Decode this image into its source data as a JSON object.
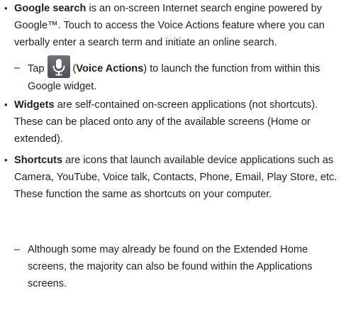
{
  "google_search": {
    "term": "Google search",
    "description": " is an on-screen Internet search engine powered by Google™. Touch to access the Voice Actions feature where you can verbally enter a search term and initiate an online search.",
    "sub_prefix": "Tap",
    "voice_actions_label": "Voice Actions",
    "sub_suffix": " to launch the function from within this Google widget.",
    "icon": "microphone-icon"
  },
  "widgets": {
    "term": "Widgets",
    "description": " are self-contained on-screen applications (not shortcuts). These can be placed onto any of the available screens (Home or extended)."
  },
  "shortcuts": {
    "term": "Shortcuts",
    "description": " are icons that launch available device applications such as Camera, YouTube, Voice talk, Contacts, Phone, Email, Play Store, etc. These function the same as shortcuts on your computer.",
    "sub_text": "Although some may already be found on the Extended Home screens, the majority can also be found within the Applications screens."
  },
  "symbols": {
    "bullet": "•",
    "dash": "–",
    "paren_open": "(",
    "paren_close": ")"
  }
}
